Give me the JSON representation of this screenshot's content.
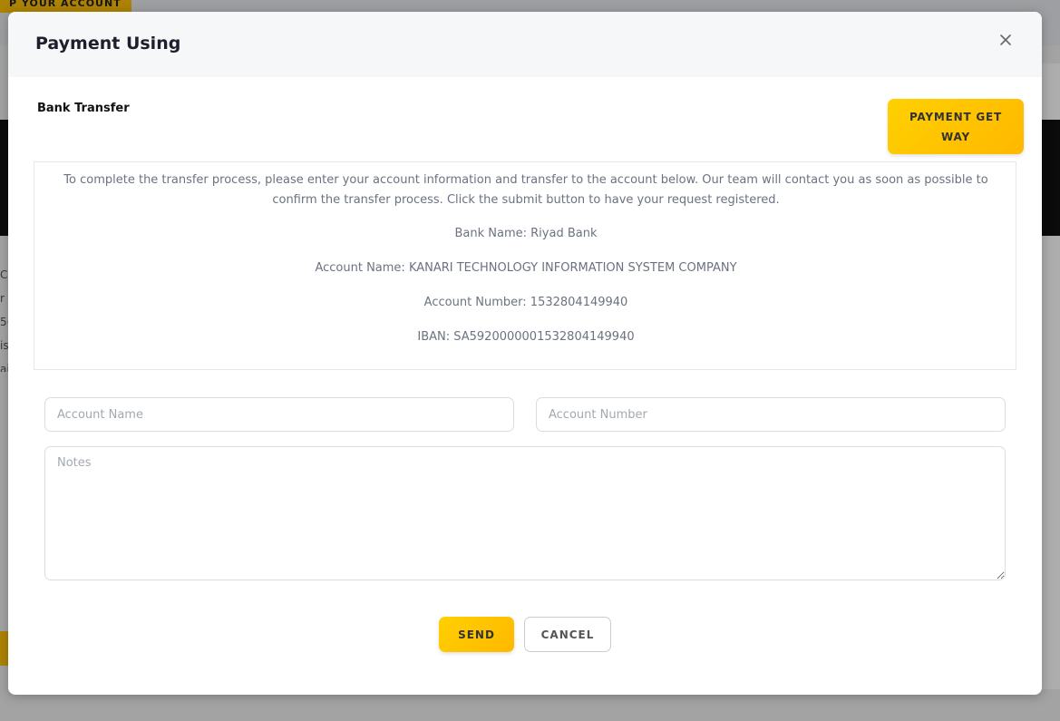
{
  "background": {
    "top_button_label": "P YOUR ACCOUNT",
    "side_text": "C r 5( is ai"
  },
  "modal": {
    "title": "Payment Using",
    "section_label": "Bank Transfer",
    "gateway_button_label": "PAYMENT GET WAY",
    "info": {
      "intro": "To complete the transfer process, please enter your account information and transfer to the account below. Our team will contact you as soon as possible to confirm the transfer process. Click the submit button to have your request registered.",
      "bank_name": "Bank Name: Riyad Bank",
      "account_name": "Account Name: KANARI TECHNOLOGY INFORMATION SYSTEM COMPANY",
      "account_number": "Account Number: 1532804149940",
      "iban": "IBAN: SA5920000001532804149940"
    },
    "form": {
      "account_name_placeholder": "Account Name",
      "account_name_value": "",
      "account_number_placeholder": "Account Number",
      "account_number_value": "",
      "notes_placeholder": "Notes",
      "notes_value": ""
    },
    "send_label": "SEND",
    "cancel_label": "CANCEL"
  },
  "colors": {
    "accent": "#ffc107",
    "header_bg": "#f5f7f9",
    "info_text": "#6b7280"
  },
  "icons": {
    "close": "close-icon"
  }
}
